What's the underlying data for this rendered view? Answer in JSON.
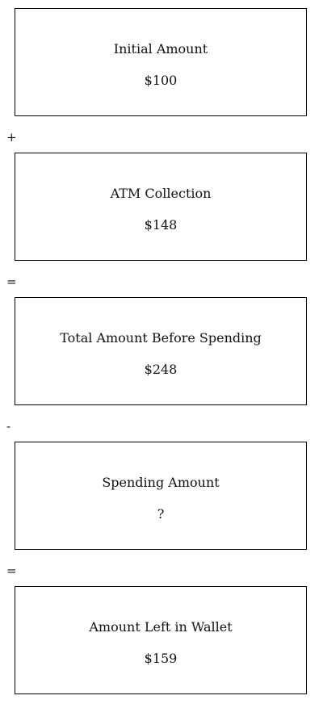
{
  "steps": [
    {
      "title": "Initial Amount",
      "value": "$100"
    },
    {
      "title": "ATM Collection",
      "value": "$148"
    },
    {
      "title": "Total Amount Before Spending",
      "value": "$248"
    },
    {
      "title": "Spending Amount",
      "value": "?"
    },
    {
      "title": "Amount Left in Wallet",
      "value": "$159"
    }
  ],
  "operators": [
    "+",
    "=",
    "-",
    "="
  ]
}
